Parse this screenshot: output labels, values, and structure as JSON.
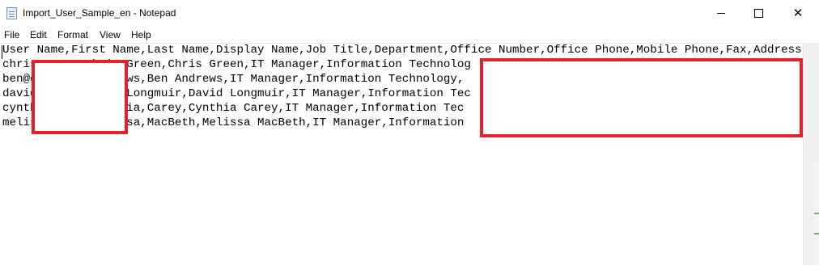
{
  "window": {
    "title": "Import_User_Sample_en - Notepad",
    "controls": [
      "minimize",
      "maximize",
      "close"
    ]
  },
  "menu": [
    "File",
    "Edit",
    "Format",
    "View",
    "Help"
  ],
  "editor": {
    "lines": [
      "User Name,First Name,Last Name,Display Name,Job Title,Department,Office Number,Office Phone,Mobile Phone,Fax,Address,City,St",
      "chris        hris,Green,Chris Green,IT Manager,Information Technolog",
      "ben@c        Andrews,Ben Andrews,IT Manager,Information Technology,",
      "david        avid,Longmuir,David Longmuir,IT Manager,Information Tec",
      "cynth        Cynthia,Carey,Cynthia Carey,IT Manager,Information Tec",
      "melis        Melissa,MacBeth,Melissa MacBeth,IT Manager,Information"
    ]
  },
  "annotations": {
    "redaction_color": "#e0222b"
  }
}
